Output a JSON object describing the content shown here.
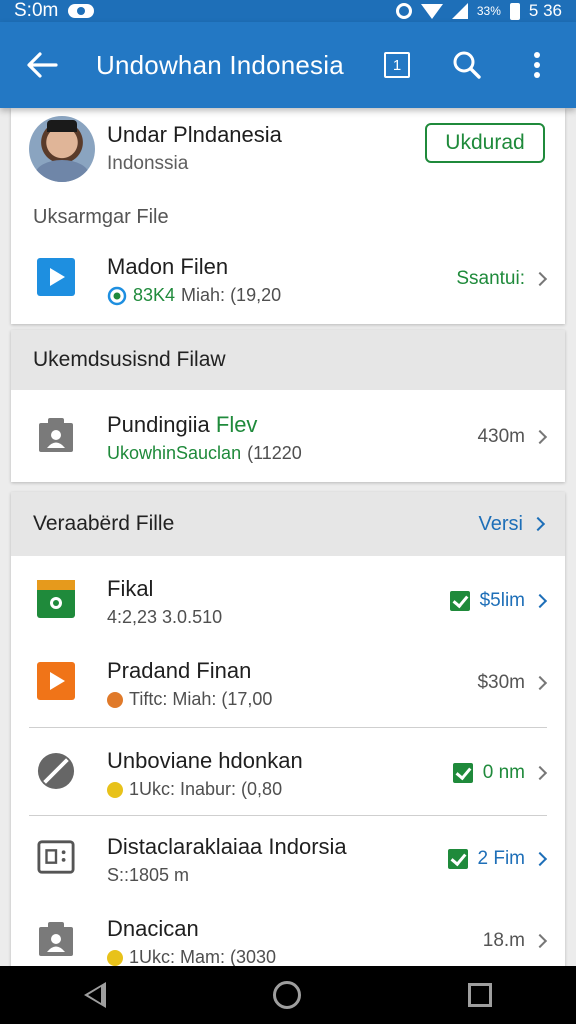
{
  "status_bar": {
    "time": "S:0m",
    "battery_text": "33%",
    "clock_right": "5 36"
  },
  "app_bar": {
    "title": "Undowhan Indonesia",
    "icons": [
      "back-arrow-icon",
      "tab-count-icon",
      "search-icon",
      "more-vert-icon"
    ],
    "tab_count": "1"
  },
  "profile": {
    "name": "Undar Plndanesia",
    "subtitle": "Indonssia",
    "button_label": "Ukdurad"
  },
  "section1": {
    "label": "Uksarmgar File",
    "row": {
      "title": "Madon Filen",
      "sub_badge": "83K4",
      "sub_text": "Miah: (19,20",
      "meta": "Ssantui:"
    }
  },
  "section2": {
    "header": "Ukemdsusisnd Filaw",
    "row": {
      "title_prefix": "Pundingiia ",
      "title_accent": "Flev",
      "sub_accent": "UkowhinSauclan",
      "sub_text": "(11220",
      "meta": "430m"
    }
  },
  "section3": {
    "header": "Veraabërd Fille",
    "header_action": "Versi",
    "rows": [
      {
        "title": "Fikal",
        "sub_text": "4:2,23 3.0.510",
        "meta": "$5lim",
        "checked": true,
        "meta_color": "#1e6fb8"
      },
      {
        "title": "Pradand Finan",
        "sub_text": "Tiftc: Miah: (17,00",
        "meta": "$30m",
        "checked": false,
        "meta_color": "#555555"
      },
      {
        "title": "Unboviane hdonkan",
        "sub_text": "1Ukc: Inabur: (0,80",
        "meta": "0 nm",
        "checked": true,
        "meta_color": "#1f8a3b"
      },
      {
        "title": "Distaclaraklaiaa Indorsia",
        "sub_text": "S::1805 m",
        "meta": "2 Fim",
        "checked": true,
        "meta_color": "#1e6fb8"
      },
      {
        "title": "Dnacican",
        "sub_text": "1Ukc: Mam: (3030",
        "meta": "18.m",
        "checked": false,
        "meta_color": "#555555"
      }
    ]
  },
  "colors": {
    "app_bar": "#2378c4",
    "status_bar": "#1e6fb8",
    "accent_green": "#1f8a3b",
    "accent_blue": "#1e6fb8"
  }
}
